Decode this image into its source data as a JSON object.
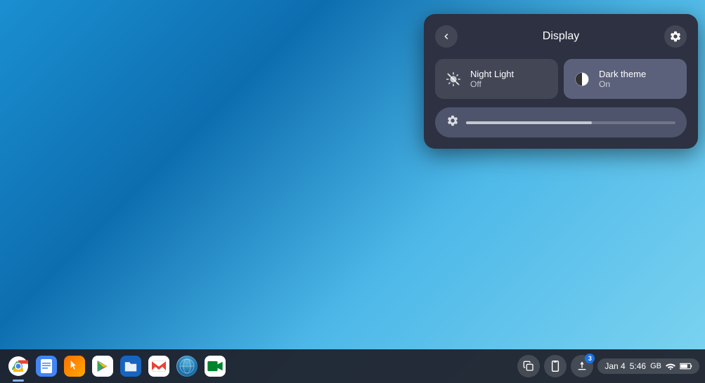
{
  "desktop": {
    "background": "blue gradient"
  },
  "panel": {
    "title": "Display",
    "back_label": "‹",
    "settings_label": "⚙",
    "night_light": {
      "label": "Night Light",
      "status": "Off",
      "active": false
    },
    "dark_theme": {
      "label": "Dark theme",
      "status": "On",
      "active": true
    },
    "brightness": {
      "icon": "⚙",
      "value": 60
    }
  },
  "taskbar": {
    "apps": [
      {
        "name": "Chrome",
        "icon": "chrome",
        "active": true
      },
      {
        "name": "Docs",
        "icon": "docs",
        "active": false
      },
      {
        "name": "Touchpad",
        "icon": "cursor",
        "active": false
      },
      {
        "name": "Play Store",
        "icon": "play",
        "active": false
      },
      {
        "name": "Files",
        "icon": "files",
        "active": false
      },
      {
        "name": "Gmail",
        "icon": "gmail",
        "active": false
      },
      {
        "name": "Safari",
        "icon": "safari",
        "active": false
      },
      {
        "name": "Meet",
        "icon": "meet",
        "active": false
      }
    ],
    "tray": {
      "copy_icon": "⧉",
      "phone_icon": "📱",
      "upload_icon": "↑",
      "notification_count": "3",
      "date": "Jan 4",
      "time": "5:46",
      "storage": "GB",
      "wifi_icon": "▲",
      "battery_icon": "🔋"
    }
  }
}
